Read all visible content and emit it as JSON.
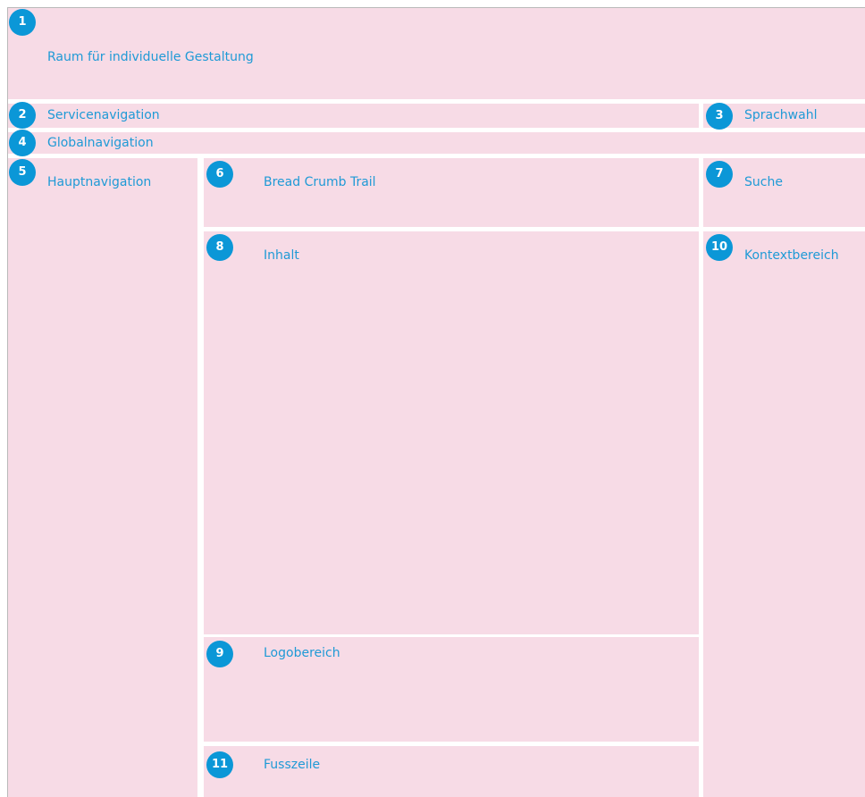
{
  "regions": {
    "individual": {
      "number": "1",
      "label": "Raum für individuelle Gestaltung"
    },
    "service_nav": {
      "number": "2",
      "label": "Servicenavigation"
    },
    "language": {
      "number": "3",
      "label": "Sprachwahl"
    },
    "global_nav": {
      "number": "4",
      "label": "Globalnavigation"
    },
    "main_nav": {
      "number": "5",
      "label": "Hauptnavigation"
    },
    "breadcrumb": {
      "number": "6",
      "label": "Bread Crumb Trail"
    },
    "search": {
      "number": "7",
      "label": "Suche"
    },
    "content": {
      "number": "8",
      "label": "Inhalt"
    },
    "logo": {
      "number": "9",
      "label": "Logobereich"
    },
    "context": {
      "number": "10",
      "label": "Kontextbereich"
    },
    "footer": {
      "number": "11",
      "label": "Fusszeile"
    }
  },
  "colors": {
    "region_fill": "#f7dbe6",
    "badge": "#0b97d7",
    "label_text": "#1f9ad6",
    "separator": "#ffffff"
  }
}
